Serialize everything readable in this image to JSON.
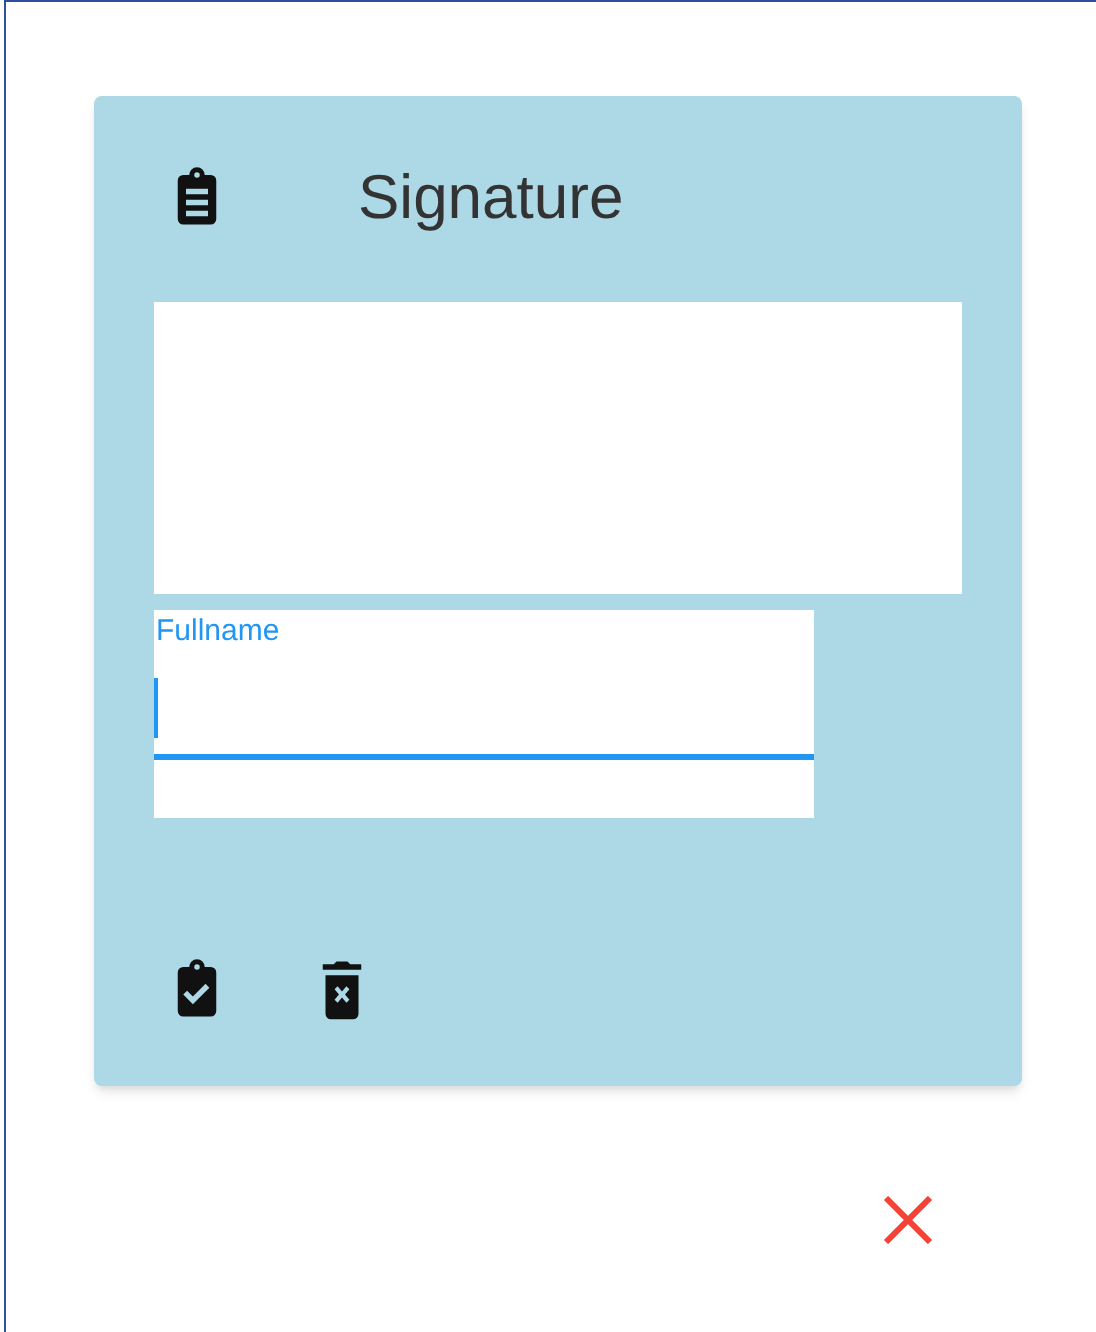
{
  "card": {
    "title": "Signature"
  },
  "fullname_field": {
    "label": "Fullname",
    "focused": true
  },
  "actions": [
    {
      "kind": "confirm"
    },
    {
      "kind": "delete"
    }
  ],
  "close_button": {
    "kind": "close"
  }
}
